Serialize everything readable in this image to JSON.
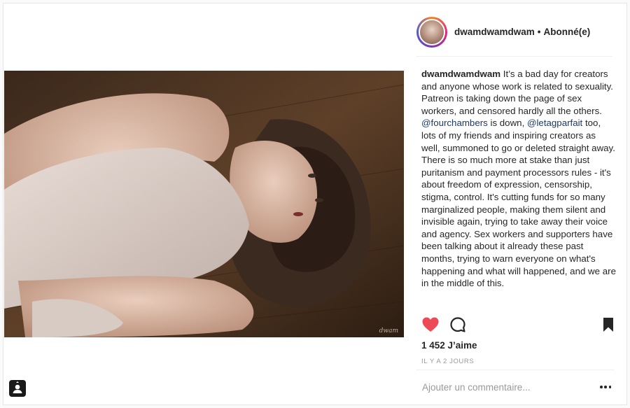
{
  "header": {
    "username": "dwamdwamdwam",
    "separator": "•",
    "follow_status": "Abonné(e)"
  },
  "photo": {
    "signature": "dwam"
  },
  "caption": {
    "username": "dwamdwamdwam",
    "text_1": " It’s a bad day for creators and anyone whose work is related to sexuality. Patreon is taking down the page of sex workers, and censored hardly all the others. ",
    "mention_1": "@fourchambers",
    "text_2": " is down, ",
    "mention_2": "@letagparfait",
    "text_3": " too, lots of my friends and inspiring creators as well, summoned to go or deleted straight away.",
    "paragraph_2": "There is so much more at stake than just puritanism and payment processors rules - it's about freedom of expression, censorship, stigma, control. It's cutting funds for so many marginalized people, making them silent and invisible again, trying to take away their voice and agency. Sex workers and supporters have been talking about it already these past months, trying to warn everyone on what's happening and what will happened, and we are in the middle of this."
  },
  "actions": {
    "like_icon": "heart-filled-icon",
    "comment_icon": "comment-bubble-icon",
    "save_icon": "bookmark-icon"
  },
  "likes": "1 452 J’aime",
  "timestamp": "IL Y A 2 JOURS",
  "comment": {
    "placeholder": "Ajouter un commentaire..."
  },
  "colors": {
    "like_red": "#ed4956",
    "mention_blue": "#1a3a6b",
    "muted_gray": "#999999"
  }
}
